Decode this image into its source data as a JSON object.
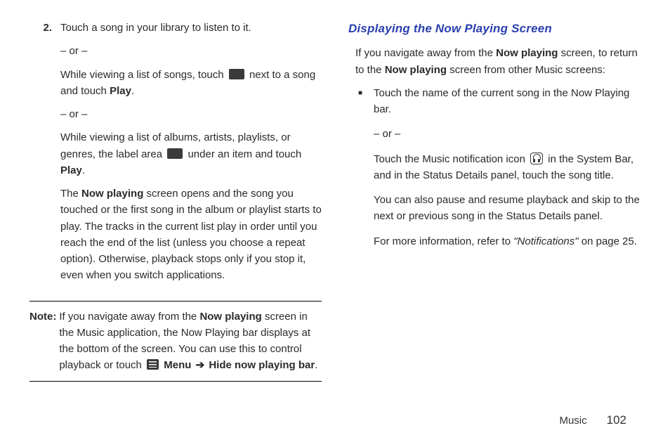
{
  "left": {
    "step_num": "2.",
    "step_line1": "Touch a song in your library to listen to it.",
    "or1": "– or –",
    "p2a": "While viewing a list of songs, touch ",
    "p2b": " next to a song and touch ",
    "p2_play": "Play",
    "p2c": ".",
    "or2": "– or –",
    "p3a": "While viewing a list of albums, artists, playlists, or genres, the label area ",
    "p3b": " under an item and touch ",
    "p3_play": "Play",
    "p3c": ".",
    "p4a": "The ",
    "p4_np": "Now playing",
    "p4b": " screen opens and the song you touched or the first song in the album or playlist starts to play. The tracks in the current list play in order until you reach the end of the list (unless you choose a repeat option). Otherwise, playback stops only if you stop it, even when you switch applications.",
    "note_label": "Note:",
    "note_a": "If you navigate away from the ",
    "note_np": "Now playing",
    "note_b": " screen in the Music application, the Now Playing bar displays at the bottom of the screen. You can use this to control playback or touch ",
    "note_menu": "Menu",
    "note_arrow": "➔",
    "note_hide": "Hide now playing bar",
    "note_c": "."
  },
  "right": {
    "heading": "Displaying the Now Playing Screen",
    "intro_a": "If you navigate away from the ",
    "intro_np1": "Now playing",
    "intro_b": " screen, to return to the ",
    "intro_np2": "Now playing",
    "intro_c": " screen from other Music screens:",
    "b1": "Touch the name of the current song in the Now Playing bar.",
    "or": "– or –",
    "b2a": "Touch the Music notification icon ",
    "b2b": " in the System Bar, and in the Status Details panel, touch the song title.",
    "b3": "You can also pause and resume playback and skip to the next or previous song in the Status Details panel.",
    "b4a": "For more information, refer to ",
    "b4q": "\"Notifications\"",
    "b4b": "  on page 25."
  },
  "footer": {
    "section": "Music",
    "page": "102"
  }
}
